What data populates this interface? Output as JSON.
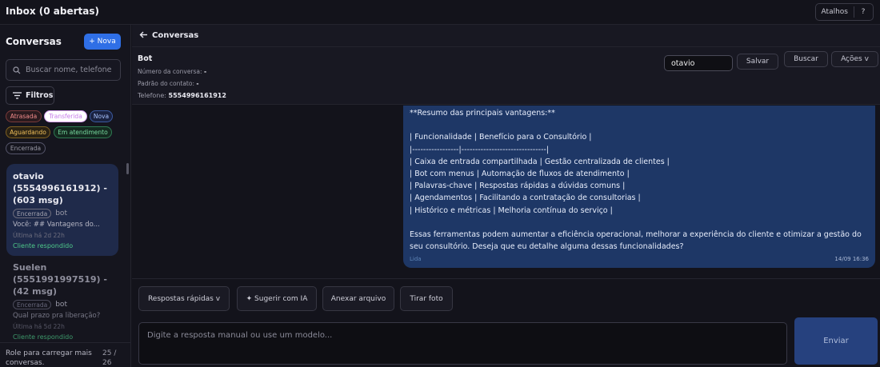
{
  "topbar": {
    "title": "Inbox (0 abertas)",
    "shortcuts_label": "Atalhos",
    "help_label": "?"
  },
  "sidebar": {
    "title": "Conversas",
    "new_button": "+ Nova",
    "search_placeholder": "Buscar nome, telefone",
    "filters_button": "Filtros",
    "chips": [
      "Atrasada",
      "Transferida",
      "Nova",
      "Aguardando",
      "Em atendimento",
      "Encerrada"
    ],
    "conversations": [
      {
        "name": "otavio (5554996161912) - (603 msg)",
        "tag": "Encerrada",
        "owner": "bot",
        "last_message": "Você: ## Vantagens do...",
        "time": "Última há 2d 22h",
        "status": "Cliente respondido"
      },
      {
        "name": "Suelen (5551991997519) - (42 msg)",
        "tag": "Encerrada",
        "owner": "bot",
        "last_message": "Qual prazo pra liberação?",
        "time": "Última há 5d 22h",
        "status": "Cliente respondido"
      }
    ],
    "footer_hint": "Role para carregar mais conversas.",
    "footer_count": "25 / 26"
  },
  "header": {
    "back_label": "Conversas",
    "contact_name": "Bot",
    "conversation_number_label": "Número da conversa:",
    "conversation_number_value": "-",
    "contact_pattern_label": "Padrão do contato:",
    "contact_pattern_value": "-",
    "phone_label": "Telefone:",
    "phone_value": "5554996161912",
    "nickname_value": "otavio",
    "save_button": "Salvar",
    "search_button": "Buscar",
    "actions_button": "Ações v"
  },
  "message": {
    "text": "**Resumo das principais vantagens:**\n\n| Funcionalidade | Benefício para o Consultório |\n|-----------------|-------------------------------|\n| Caixa de entrada compartilhada | Gestão centralizada de clientes |\n| Bot com menus | Automação de fluxos de atendimento |\n| Palavras-chave | Respostas rápidas a dúvidas comuns |\n| Agendamentos | Facilitando a contratação de consultorias |\n| Histórico e métricas | Melhoria contínua do serviço |\n\nEssas ferramentas podem aumentar a eficiência operacional, melhorar a experiência do cliente e otimizar a gestão do seu consultório. Deseja que eu detalhe alguma dessas funcionalidades?",
    "read_label": "Lida",
    "timestamp": "14/09 16:36"
  },
  "actions": {
    "quick_replies": "Respostas rápidas v",
    "suggest_ai": "✦ Sugerir com IA",
    "attach_file": "Anexar arquivo",
    "take_photo": "Tirar foto"
  },
  "composer": {
    "placeholder": "Digite a resposta manual ou use um modelo...",
    "send_button": "Enviar"
  },
  "colors": {
    "accent": "#2f6fe6",
    "bubble": "#1e3766",
    "success": "#4ec98a"
  }
}
